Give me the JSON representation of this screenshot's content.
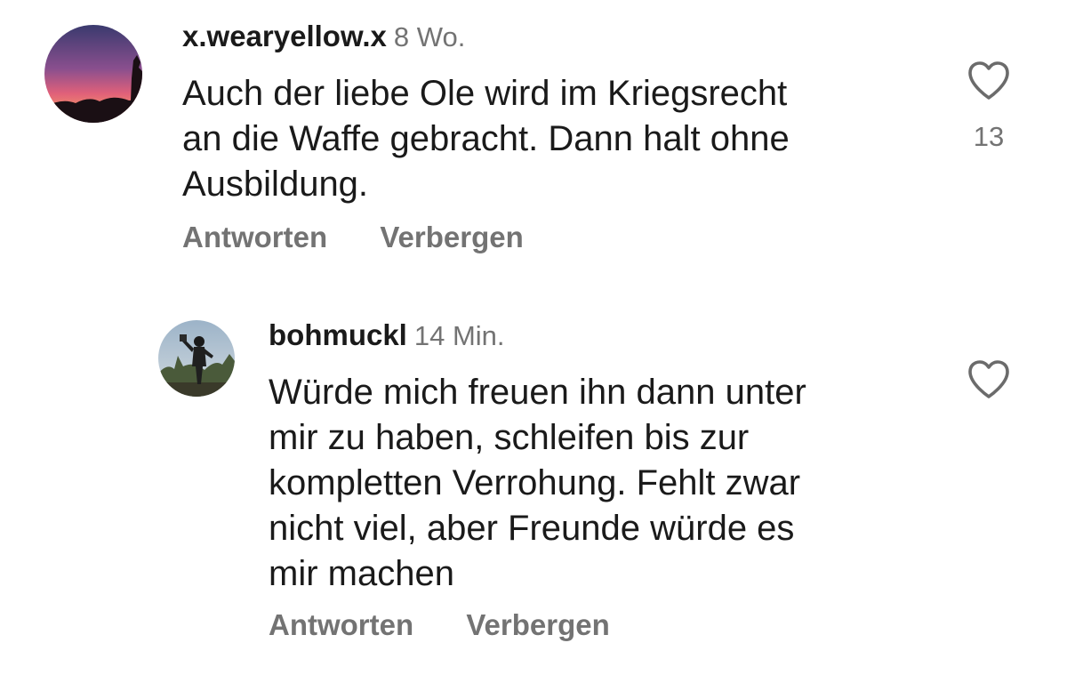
{
  "comments": [
    {
      "username": "x.wearyellow.x",
      "time": "8 Wo.",
      "lines": [
        "Auch der liebe Ole wird im Kriegsrecht",
        "an die Waffe gebracht. Dann halt ohne",
        "Ausbildung."
      ],
      "like_count": "13",
      "reply_label": "Antworten",
      "hide_label": "Verbergen"
    },
    {
      "username": "bohmuckl",
      "time": "14 Min.",
      "lines": [
        "Würde mich freuen ihn dann unter",
        "mir zu haben, schleifen bis zur",
        "kompletten Verrohung. Fehlt zwar",
        "nicht viel, aber Freunde würde es",
        "mir machen"
      ],
      "reply_label": "Antworten",
      "hide_label": "Verbergen"
    }
  ],
  "colors": {
    "text": "#1a1a1a",
    "muted": "#737373",
    "heart_outline": "#6b6b6b"
  },
  "icons": [
    "avatar-sunset",
    "avatar-person",
    "heart-outline-icon"
  ]
}
